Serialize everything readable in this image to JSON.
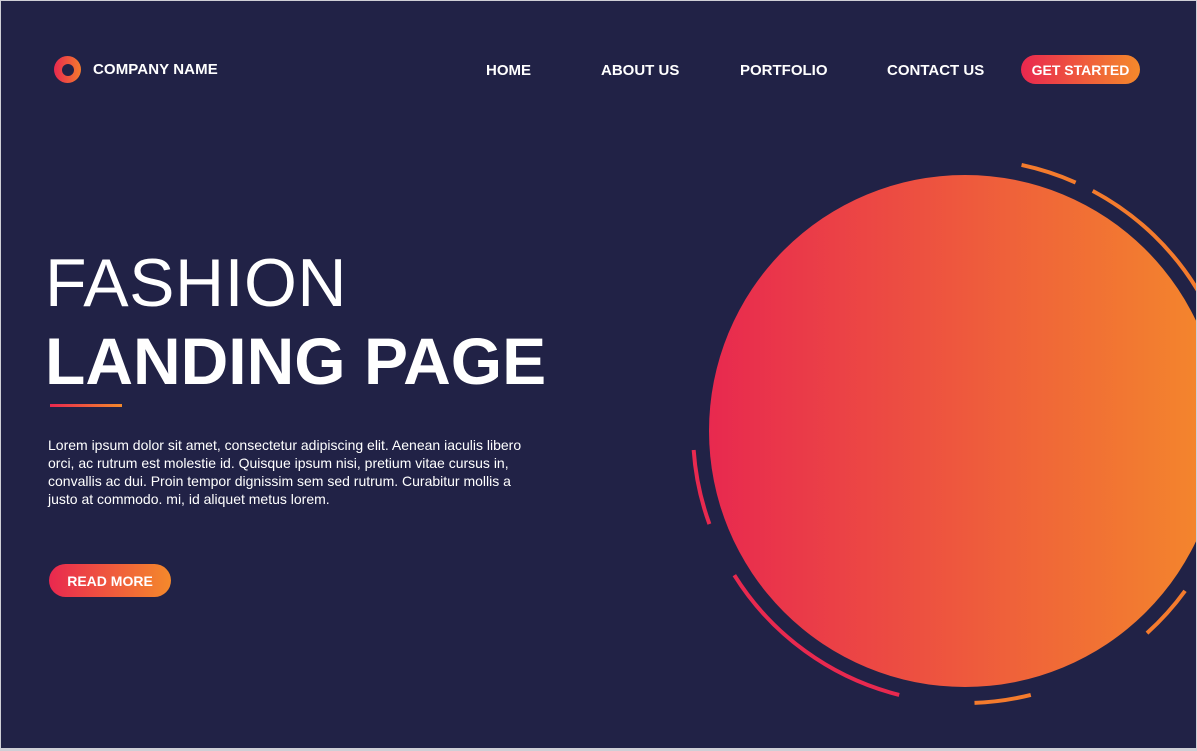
{
  "header": {
    "company_name": "COMPANY NAME",
    "nav": [
      {
        "label": "HOME"
      },
      {
        "label": "ABOUT US"
      },
      {
        "label": "PORTFOLIO"
      },
      {
        "label": "CONTACT US"
      }
    ],
    "cta_label": "GET STARTED"
  },
  "hero": {
    "title_line1": "FASHION",
    "title_line2": "LANDING PAGE",
    "body": "Lorem ipsum dolor sit amet, consectetur adipiscing elit. Aenean iaculis libero orci, ac rutrum est molestie id. Quisque ipsum nisi, pretium vitae cursus in, convallis ac dui. Proin tempor dignissim sem sed rutrum. Curabitur mollis a justo at commodo. mi, id aliquet metus lorem.",
    "button_label": "READ MORE"
  },
  "theme": {
    "background": "#212246",
    "gradient_start": "#e9284f",
    "gradient_end": "#f4892b",
    "text": "#ffffff"
  },
  "icons": {
    "logo": "ring-logo-icon"
  }
}
